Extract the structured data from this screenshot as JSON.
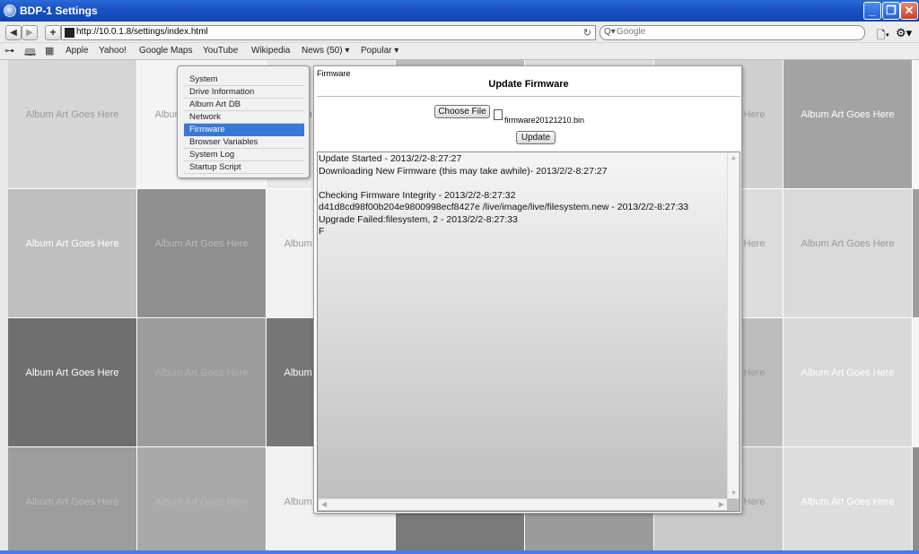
{
  "window": {
    "title": "BDP-1 Settings",
    "minimize": "_",
    "maximize": "❐",
    "close": "✕"
  },
  "toolbar": {
    "back": "◀",
    "forward": "▶",
    "add": "+",
    "url": "http://10.0.1.8/settings/index.html",
    "reload": "↻",
    "search_icon": "Q▾",
    "search_placeholder": "Google",
    "page_menu": "🗋▾",
    "settings_menu": "⚙▾"
  },
  "bookmarks": {
    "icons": [
      "reading-list-icon",
      "bookmarks-icon",
      "top-sites-icon"
    ],
    "items": [
      "Apple",
      "Yahoo!",
      "Google Maps",
      "YouTube",
      "Wikipedia",
      "News (50) ▾",
      "Popular ▾"
    ]
  },
  "album_tile_label": "Album Art Goes Here",
  "tiles": {
    "shades": [
      [
        "#d6d6d6",
        "#f4f4f4",
        "#e9e9e9",
        "#bdbdbd",
        "#dcdcdc",
        "#cfcfcf",
        "#a3a3a3",
        "#f6f6f6"
      ],
      [
        "#bfbfbf",
        "#8f8f8f",
        "#f1f1f1",
        "#c6c6c6",
        "#8e8e8e",
        "#dcdcdc",
        "#dadada",
        "#9d9d9d"
      ],
      [
        "#6f6f6f",
        "#9c9c9c",
        "#767676",
        "#c7c7c7",
        "#8c8c8c",
        "#bdbdbd",
        "#d9d9d9",
        "#f4f4f4"
      ],
      [
        "#9d9d9d",
        "#a9a9a9",
        "#f1f1f1",
        "#7a7a7a",
        "#9b9b9b",
        "#c9c9c9",
        "#dddddd",
        "#8f8f8f"
      ]
    ],
    "text_colors": [
      [
        "#999999",
        "#999999",
        "#888888",
        "#ffffff",
        "#999999",
        "#999999",
        "#ffffff",
        "#888888"
      ],
      [
        "#ffffff",
        "#bbbbbb",
        "#999999",
        "#ffffff",
        "#bbbbbb",
        "#999999",
        "#999999",
        "#888888"
      ],
      [
        "#ffffff",
        "#b0b0b0",
        "#ffffff",
        "#ffffff",
        "#ffffff",
        "#999999",
        "#ffffff",
        "#888888"
      ],
      [
        "#bbbbbb",
        "#b8b8b8",
        "#999999",
        "#ffffff",
        "#ffffff",
        "#999999",
        "#ffffff",
        "#bbbbbb"
      ]
    ]
  },
  "nav_menu": {
    "items": [
      "System",
      "Drive Information",
      "Album Art DB",
      "Network",
      "Firmware",
      "Browser Variables",
      "System Log",
      "Startup Script"
    ],
    "active_index": 4,
    "accent": "#3a78d8"
  },
  "firmware": {
    "header": "Firmware",
    "title": "Update Firmware",
    "choose_file_label": "Choose File",
    "file_name": "firmware20121210.bin",
    "update_label": "Update",
    "log": [
      "Update Started - 2013/2/2-8:27:27",
      "Downloading New Firmware (this may take awhile)- 2013/2/2-8:27:27",
      "",
      "Checking Firmware Integrity - 2013/2/2-8:27:32",
      "d41d8cd98f00b204e9800998ecf8427e /live/image/live/filesystem.new - 2013/2/2-8:27:33",
      "Upgrade Failed:filesystem, 2 - 2013/2/2-8:27:33",
      "F"
    ]
  }
}
